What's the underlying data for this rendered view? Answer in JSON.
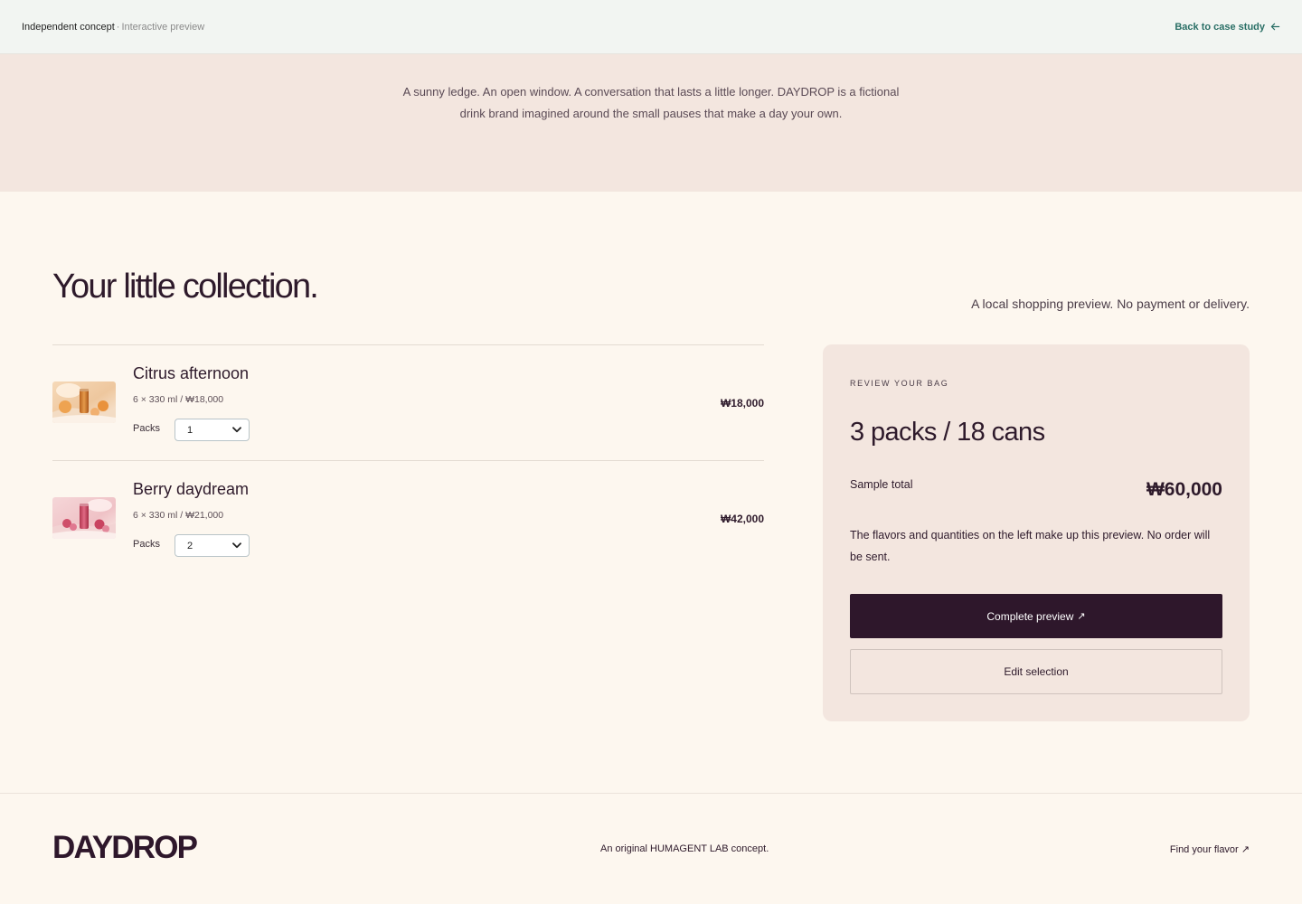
{
  "topbar": {
    "concept": "Independent concept",
    "separator": "·",
    "mode": "Interactive preview",
    "back_label": "Back to case study"
  },
  "intro": {
    "text": "A sunny ledge. An open window. A conversation that lasts a little longer. DAYDROP is a fictional drink brand imagined around the small pauses that make a day your own."
  },
  "main": {
    "title": "Your little collection.",
    "note": "A local shopping preview. No payment or delivery."
  },
  "cart": {
    "packs_label": "Packs",
    "items": [
      {
        "name": "Citrus afternoon",
        "meta": "6 × 330 ml / ₩18,000",
        "packs": "1",
        "price": "₩18,000",
        "image": "citrus-can-image",
        "accent": "#d9914a"
      },
      {
        "name": "Berry daydream",
        "meta": "6 × 330 ml / ₩21,000",
        "packs": "2",
        "price": "₩42,000",
        "image": "berry-can-image",
        "accent": "#d2607a"
      }
    ]
  },
  "summary": {
    "eyebrow": "REVIEW YOUR BAG",
    "count": "3 packs / 18 cans",
    "total_label": "Sample total",
    "total": "₩60,000",
    "description": "The flavors and quantities on the left make up this preview. No order will be sent.",
    "primary_label": "Complete preview",
    "primary_icon": "↗",
    "secondary_label": "Edit selection"
  },
  "footer": {
    "brand": "DAYDROP",
    "credit": "An original HUMAGENT LAB concept.",
    "link_label": "Find your flavor",
    "link_icon": "↗"
  },
  "colors": {
    "plum": "#2e172b",
    "teal_link": "#2a6f66",
    "blush": "#f3e6df",
    "cream": "#fdf7ef"
  }
}
